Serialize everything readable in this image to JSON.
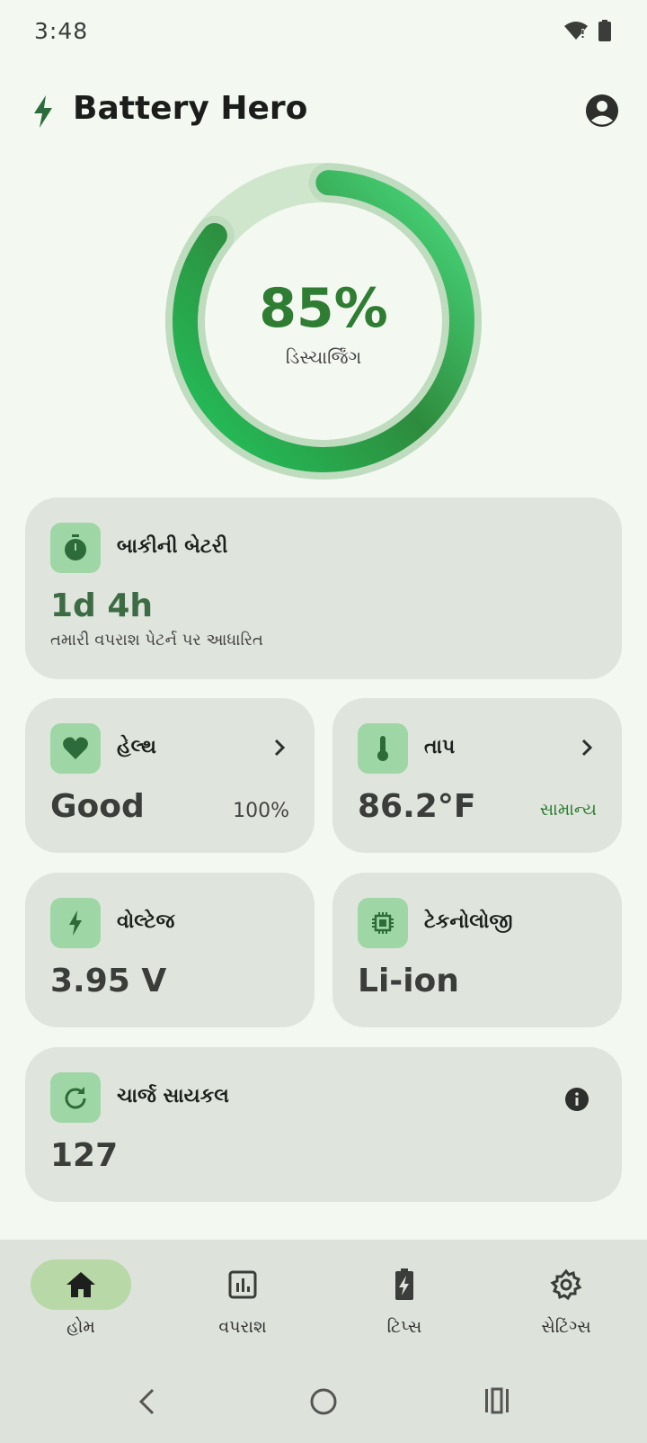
{
  "status_bar": {
    "time": "3:48"
  },
  "header": {
    "title": "Battery Hero"
  },
  "battery": {
    "percent_label": "85%",
    "level": 0.85,
    "status": "ડિસ્ચાર્જિંગ"
  },
  "remaining": {
    "title": "બાકીની બેટરી",
    "value": "1d 4h",
    "subtitle": "તમારી વપરાશ પેટર્ન પર આધારિત"
  },
  "health": {
    "title": "હેલ્થ",
    "value": "Good",
    "percent": "100%"
  },
  "temperature": {
    "title": "તાપ",
    "value": "86.2°F",
    "status": "સામાન્ય"
  },
  "voltage": {
    "title": "વોલ્ટેજ",
    "value": "3.95 V"
  },
  "technology": {
    "title": "ટેકનોલોજી",
    "value": "Li-ion"
  },
  "cycles": {
    "title": "ચાર્જ સાયકલ",
    "value": "127"
  },
  "nav": {
    "items": [
      {
        "label": "હોમ",
        "icon": "home-icon",
        "active": true
      },
      {
        "label": "વપરાશ",
        "icon": "bar-chart-icon",
        "active": false
      },
      {
        "label": "ટિપ્સ",
        "icon": "battery-bolt-icon",
        "active": false
      },
      {
        "label": "સેટિંગ્સ",
        "icon": "gear-icon",
        "active": false
      }
    ]
  },
  "colors": {
    "accent": "#2e7d32",
    "ring_light": "#4ade80",
    "card_bg": "#dfe5dd",
    "icon_bg": "#9fd6a5",
    "nav_active": "#b8d8a8"
  }
}
